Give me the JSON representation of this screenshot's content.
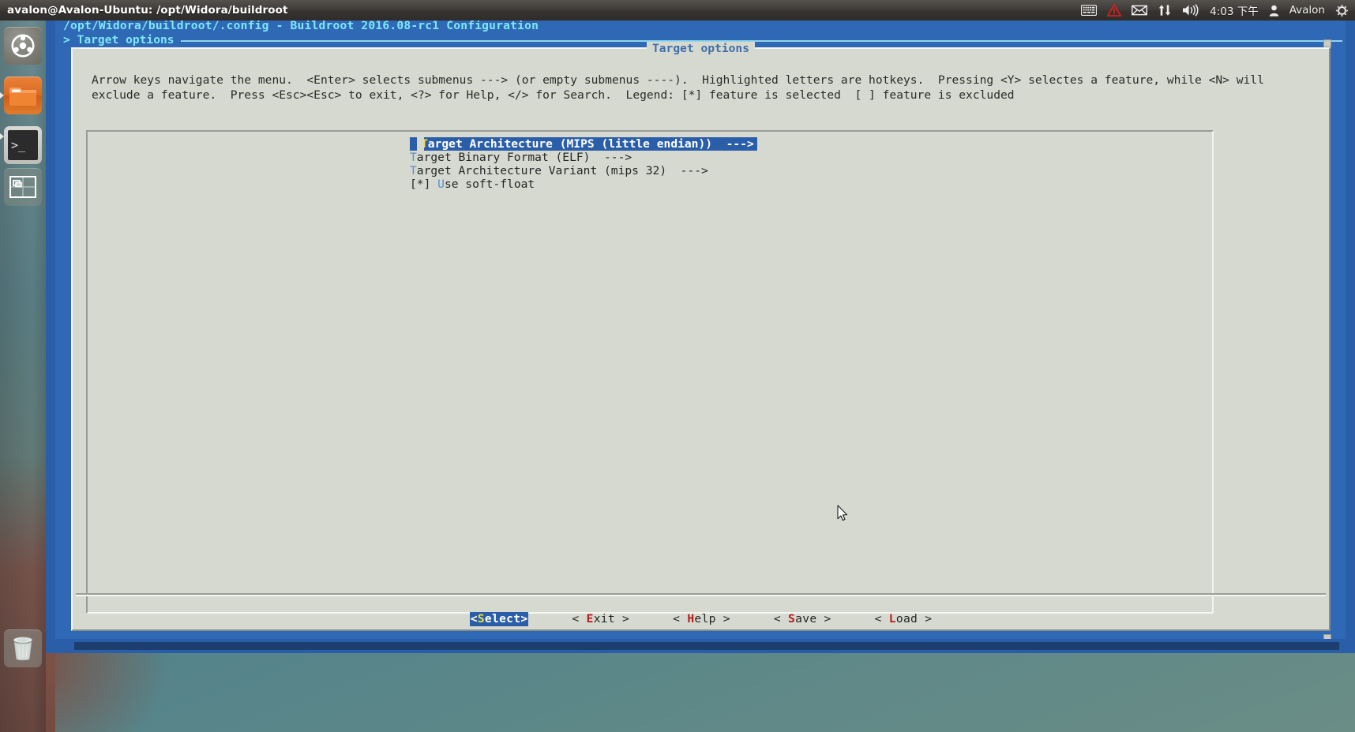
{
  "panel": {
    "window_title": "avalon@Avalon-Ubuntu: /opt/Widora/buildroot",
    "tray": {
      "keyboard_icon": "keyboard-icon",
      "warning_icon": "warning-triangle-icon",
      "mail_icon": "envelope-icon",
      "network_icon": "network-updown-icon",
      "volume_icon": "speaker-icon",
      "clock": "4:03 下午",
      "user_icon": "user-icon",
      "user_name": "Avalon",
      "settings_icon": "gear-icon"
    }
  },
  "launcher": {
    "items": [
      {
        "name": "ubuntu-dash",
        "label": "Dash"
      },
      {
        "name": "files",
        "label": "Files"
      },
      {
        "name": "terminal",
        "label": "Terminal",
        "prompt": ">_"
      },
      {
        "name": "workspace-switcher",
        "label": "Workspace Switcher"
      },
      {
        "name": "trash",
        "label": "Trash"
      }
    ]
  },
  "menuconfig": {
    "title": "/opt/Widora/buildroot/.config - Buildroot 2016.08-rc1 Configuration",
    "breadcrumb": "> Target options",
    "dialog_heading": "Target options",
    "help_text": "Arrow keys navigate the menu.  <Enter> selects submenus ---> (or empty submenus ----).  Highlighted letters are hotkeys.  Pressing <Y> selectes a feature, while <N> will\nexclude a feature.  Press <Esc><Esc> to exit, <?> for Help, </> for Search.  Legend: [*] feature is selected  [ ] feature is excluded",
    "items": [
      {
        "prefix": "",
        "hotkey": "T",
        "text": "arget Architecture (MIPS (little endian))",
        "suffix": "  --->",
        "selected": true
      },
      {
        "prefix": "",
        "hotkey": "T",
        "text": "arget Binary Format (ELF)",
        "suffix": "  --->",
        "selected": false
      },
      {
        "prefix": "",
        "hotkey": "T",
        "text": "arget Architecture Variant (mips 32)",
        "suffix": "  --->",
        "selected": false
      },
      {
        "prefix": "[*] ",
        "hotkey": "U",
        "text": "se soft-float",
        "suffix": "",
        "selected": false
      }
    ],
    "buttons": [
      {
        "name": "select",
        "pre": "<",
        "hk": "S",
        "post": "elect>",
        "active": true
      },
      {
        "name": "exit",
        "pre": "< ",
        "hk": "E",
        "post": "xit >",
        "active": false
      },
      {
        "name": "help",
        "pre": "< ",
        "hk": "H",
        "post": "elp >",
        "active": false
      },
      {
        "name": "save",
        "pre": "< ",
        "hk": "S",
        "post": "ave >",
        "active": false
      },
      {
        "name": "load",
        "pre": "< ",
        "hk": "L",
        "post": "oad >",
        "active": false
      }
    ]
  },
  "colors": {
    "dialog_bg": "#d6d9d0",
    "terminal_bg": "#2f68b5",
    "highlight_blue": "#2b5ea8",
    "title_cyan": "#7fe8f5",
    "hotkey_blue": "#5b8fc9",
    "hotkey_yellow": "#f0e23c",
    "hotkey_red": "#b71c1c"
  }
}
